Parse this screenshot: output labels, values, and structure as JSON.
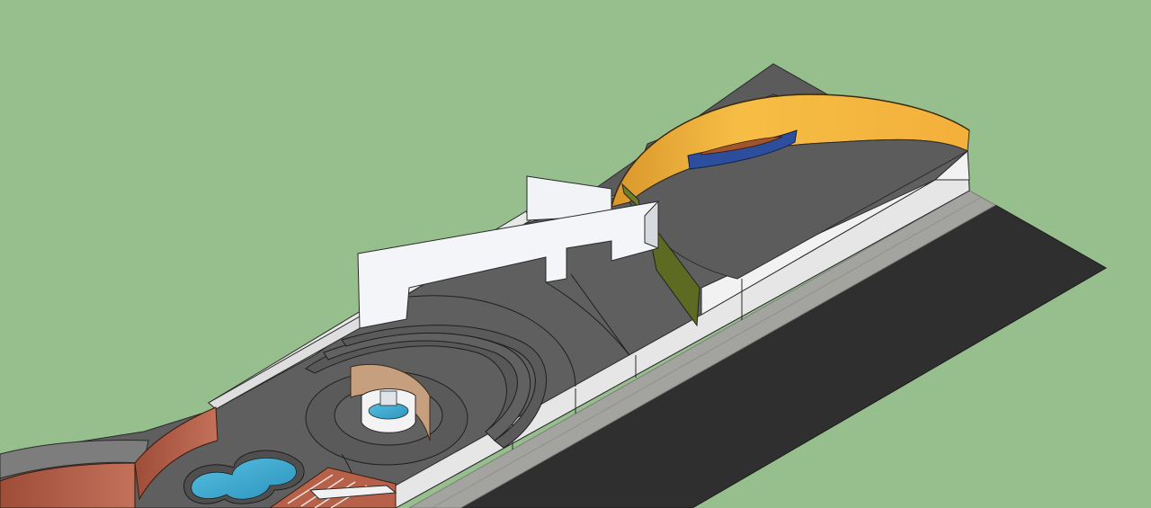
{
  "scene": {
    "colors": {
      "background": "#96bf8d",
      "road": "#2f2f2f",
      "sidewalk": "#a3a3a0",
      "plaza_floor": "#5f5f5f",
      "boundary_wall": "#ebebeb",
      "white_walls": "#f1f3f7",
      "yellow_wall": "#f4b53d",
      "blue_bench": "#2c4e9c",
      "green_panel": "#5d6b22",
      "brick_wall": "#b8614a",
      "pool_water": "#3fa9cf",
      "tan_shell": "#c69f7e"
    }
  }
}
